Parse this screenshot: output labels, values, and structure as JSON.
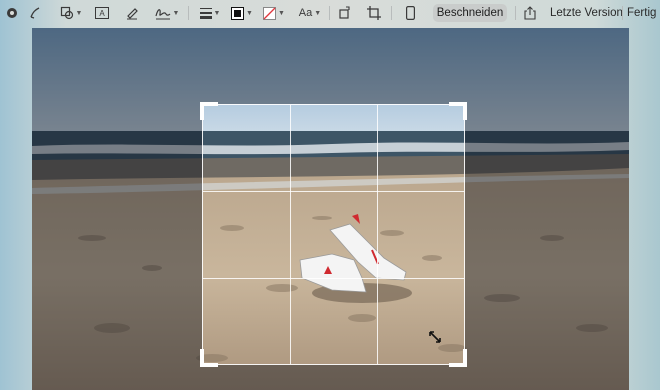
{
  "toolbar": {
    "items": [
      {
        "name": "markup-icon"
      },
      {
        "name": "sketch-icon"
      },
      {
        "name": "shapes-icon"
      },
      {
        "name": "text-icon"
      },
      {
        "name": "highlight-icon"
      },
      {
        "name": "signature-icon"
      },
      {
        "name": "line-style-icon"
      },
      {
        "name": "border-color-icon"
      },
      {
        "name": "fill-color-icon"
      },
      {
        "name": "text-style-icon",
        "label": "Aa"
      },
      {
        "name": "rotate-icon"
      },
      {
        "name": "crop-icon"
      },
      {
        "name": "device-icon"
      },
      {
        "name": "share-icon"
      }
    ],
    "crop_button": "Beschneiden",
    "revert_button": "Letzte Version",
    "done_button": "Fertig"
  },
  "canvas": {
    "crop_grid": "3x3"
  },
  "colors": {
    "toolbar_bg": "#d9dcd9",
    "crop_btn_bg": "#c9cccb",
    "sky": "#8fb6d6",
    "sand": "#c8b397"
  }
}
